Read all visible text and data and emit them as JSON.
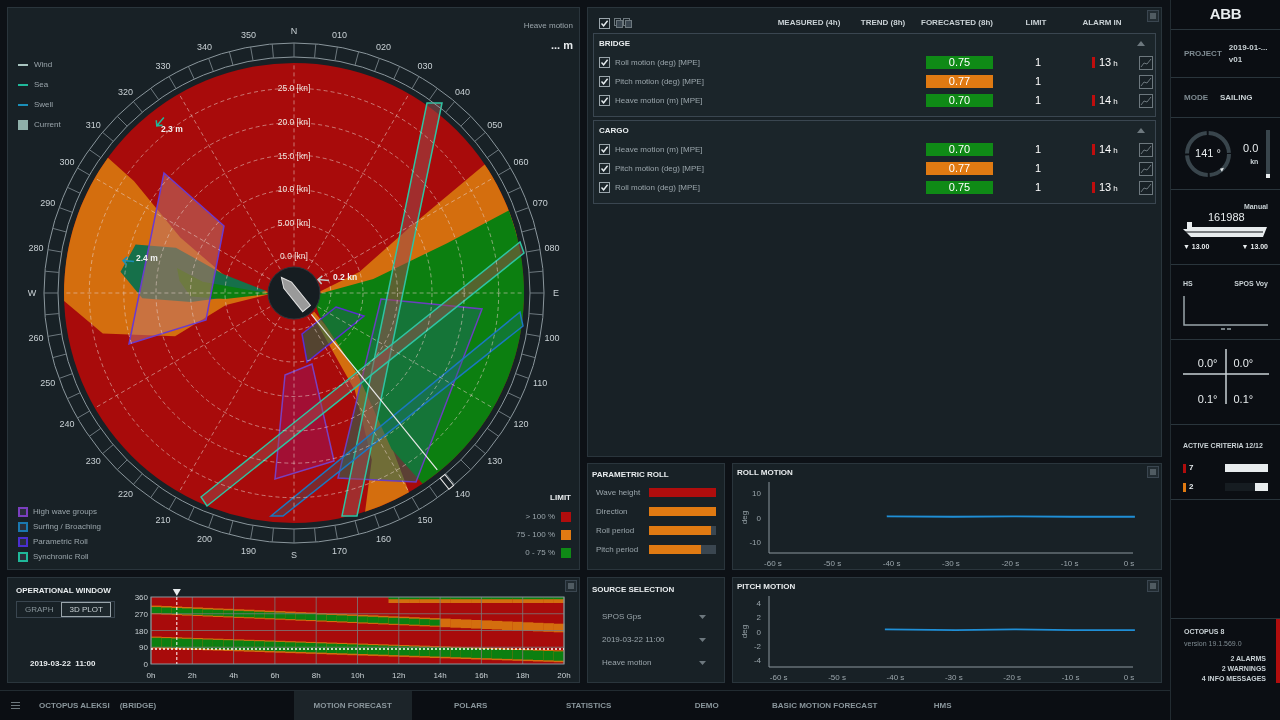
{
  "polar": {
    "title": "Heave motion",
    "value": "... m",
    "legend": [
      {
        "label": "Wind",
        "kind": "line",
        "color": "#a9c4c0"
      },
      {
        "label": "Sea",
        "kind": "line",
        "color": "#1fb89a"
      },
      {
        "label": "Swell",
        "kind": "line",
        "color": "#1a8fb8"
      },
      {
        "label": "Current",
        "kind": "square",
        "color": "#8fb0aa"
      }
    ],
    "bearings": [
      "N",
      "350",
      "010",
      "340",
      "020",
      "330",
      "030",
      "320",
      "040",
      "310",
      "050",
      "300",
      "060",
      "290",
      "070",
      "280",
      "080",
      "W",
      "E",
      "260",
      "100",
      "250",
      "110",
      "240",
      "120",
      "230",
      "130",
      "220",
      "140",
      "210",
      "150",
      "200",
      "160",
      "190",
      "170",
      "S"
    ],
    "rings": [
      "25.0 [kn]",
      "20.0 [kn]",
      "15.0 [kn]",
      "10.0 [kn]",
      "5.00 [kn]",
      "0.0 [kn]"
    ],
    "annotations": [
      "2.3 m",
      "2.4 m",
      "0.2 kn"
    ],
    "criteria_legend": [
      {
        "label": "High wave groups",
        "color": "#7a3fbf"
      },
      {
        "label": "Surfing / Broaching",
        "color": "#1a78b0"
      },
      {
        "label": "Parametric Roll",
        "color": "#4a2fd0"
      },
      {
        "label": "Synchronic Roll",
        "color": "#1fb89a"
      }
    ],
    "limit": {
      "title": "LIMIT",
      "items": [
        {
          "label": "> 100 %",
          "color": "#b00d0d"
        },
        {
          "label": "75 - 100 %",
          "color": "#e07a12"
        },
        {
          "label": "0 - 75 %",
          "color": "#0f8a16"
        }
      ]
    }
  },
  "criteria_table": {
    "all_checked": true,
    "columns": [
      "MEASURED (4h)",
      "TREND (8h)",
      "FORECASTED (8h)",
      "LIMIT",
      "ALARM IN"
    ],
    "groups": [
      {
        "name": "BRIDGE",
        "rows": [
          {
            "checked": true,
            "label": "Roll motion (deg) [MPE]",
            "forecast": "0.75",
            "color": "#0f8a16",
            "limit": "1",
            "alarm": {
              "value": "13",
              "unit": "h"
            }
          },
          {
            "checked": true,
            "label": "Pitch motion (deg) [MPE]",
            "forecast": "0.77",
            "color": "#e07a12",
            "limit": "1"
          },
          {
            "checked": true,
            "label": "Heave motion (m) [MPE]",
            "forecast": "0.70",
            "color": "#0f8a16",
            "limit": "1",
            "alarm": {
              "value": "14",
              "unit": "h"
            }
          }
        ]
      },
      {
        "name": "CARGO",
        "rows": [
          {
            "checked": true,
            "label": "Heave motion (m) [MPE]",
            "forecast": "0.70",
            "color": "#0f8a16",
            "limit": "1",
            "alarm": {
              "value": "14",
              "unit": "h"
            }
          },
          {
            "checked": true,
            "label": "Pitch motion (deg) [MPE]",
            "forecast": "0.77",
            "color": "#e07a12",
            "limit": "1"
          },
          {
            "checked": true,
            "label": "Roll motion (deg) [MPE]",
            "forecast": "0.75",
            "color": "#0f8a16",
            "limit": "1",
            "alarm": {
              "value": "13",
              "unit": "h"
            }
          }
        ]
      }
    ]
  },
  "parametric_roll": {
    "title": "PARAMETRIC ROLL",
    "items": [
      {
        "label": "Wave height",
        "level": 1,
        "color": "#b00d0d"
      },
      {
        "label": "Direction",
        "level": 1,
        "color": "#e07a12"
      },
      {
        "label": "Roll period",
        "level": 0.92,
        "color": "#e07a12"
      },
      {
        "label": "Pitch period",
        "level": 0.77,
        "color": "#e07a12"
      }
    ]
  },
  "roll_motion": {
    "title": "ROLL MOTION",
    "chart_data": {
      "type": "line",
      "ylabel": "deg",
      "x": [
        -41,
        -30,
        -20,
        -10,
        0
      ],
      "xlim": [
        -61,
        0
      ],
      "ylim": [
        -14.5,
        14.5
      ],
      "xticks": [
        {
          "value": -60,
          "label": "-60 s"
        },
        {
          "value": -50,
          "label": "-50 s"
        },
        {
          "value": -40,
          "label": "-40 s"
        },
        {
          "value": -30,
          "label": "-30 s"
        },
        {
          "value": -20,
          "label": "-20 s"
        },
        {
          "value": -10,
          "label": "-10 s"
        },
        {
          "value": 0,
          "label": "0 s"
        }
      ],
      "yticks": [
        10,
        0,
        -10
      ],
      "series": [
        {
          "color": "#1f8fd6",
          "values": [
            0.5,
            0.3,
            0.5,
            0.3,
            0.3
          ]
        }
      ]
    }
  },
  "source_selection": {
    "title": "SOURCE SELECTION",
    "dropdowns": [
      "SPOS Gps",
      "2019-03-22 11:00",
      "Heave motion"
    ]
  },
  "pitch_motion": {
    "title": "PITCH MOTION",
    "chart_data": {
      "type": "line",
      "ylabel": "deg",
      "x": [
        -42,
        -30,
        -20,
        -10,
        0
      ],
      "xlim": [
        -62,
        0
      ],
      "ylim": [
        -5,
        5
      ],
      "xticks": [
        {
          "value": -60,
          "label": "-60 s"
        },
        {
          "value": -50,
          "label": "-50 s"
        },
        {
          "value": -40,
          "label": "-40 s"
        },
        {
          "value": -30,
          "label": "-30 s"
        },
        {
          "value": -20,
          "label": "-20 s"
        },
        {
          "value": -10,
          "label": "-10 s"
        },
        {
          "value": 0,
          "label": "0 s"
        }
      ],
      "yticks": [
        4,
        2,
        0,
        -2,
        -4
      ],
      "series": [
        {
          "color": "#1f8fd6",
          "values": [
            0.3,
            0.2,
            0.3,
            0.2,
            0.2
          ]
        }
      ]
    }
  },
  "operational_window": {
    "title": "OPERATIONAL WINDOW",
    "buttons": [
      {
        "label": "GRAPH",
        "selected": false
      },
      {
        "label": "3D PLOT",
        "selected": true
      }
    ],
    "date": "2019-03-22  11:00",
    "yticks": [
      "360",
      "270",
      "180",
      "90",
      "0"
    ],
    "xticks": [
      "0h",
      "2h",
      "4h",
      "6h",
      "8h",
      "10h",
      "12h",
      "14h",
      "16h",
      "18h",
      "20h"
    ]
  },
  "nav": {
    "vessel": "OCTOPUS ALEKSI",
    "station": "(BRIDGE)",
    "tabs": [
      {
        "label": "MOTION FORECAST",
        "selected": true
      },
      {
        "label": "POLARS",
        "selected": false
      },
      {
        "label": "STATISTICS",
        "selected": false
      },
      {
        "label": "DEMO",
        "selected": false
      },
      {
        "label": "BASIC MOTION FORECAST",
        "selected": false
      },
      {
        "label": "HMS",
        "selected": false
      }
    ]
  },
  "sidebar": {
    "logo": "ABB",
    "project": {
      "label": "PROJECT",
      "lines": [
        "2019-01-...",
        "v01"
      ]
    },
    "mode": {
      "label": "MODE",
      "value": "SAILING"
    },
    "heading": "141 °",
    "speed": {
      "value": "0.0",
      "unit": "kn",
      "level": 0.08
    },
    "ship": {
      "mode": "Manual",
      "id": "161988",
      "drafts": [
        "▼ 13.00",
        "▼ 13.00"
      ]
    },
    "hs": {
      "left": "HS",
      "right": "SPOS Voy"
    },
    "attitude": [
      "0.0°",
      "0.0°",
      "0.1°",
      "0.1°"
    ],
    "active_criteria": {
      "title": "ACTIVE CRITERIA 12/12",
      "items": [
        {
          "count": "7",
          "color": "#b00d0d",
          "level": 1
        },
        {
          "count": "2",
          "color": "#e07a12",
          "level": 0.3
        }
      ]
    },
    "footer": {
      "product": "OCTOPUS 8",
      "version": "version 19.1.569.0",
      "messages": [
        "2 ALARMS",
        "2 WARNINGS",
        "4 INFO MESSAGES"
      ]
    }
  }
}
